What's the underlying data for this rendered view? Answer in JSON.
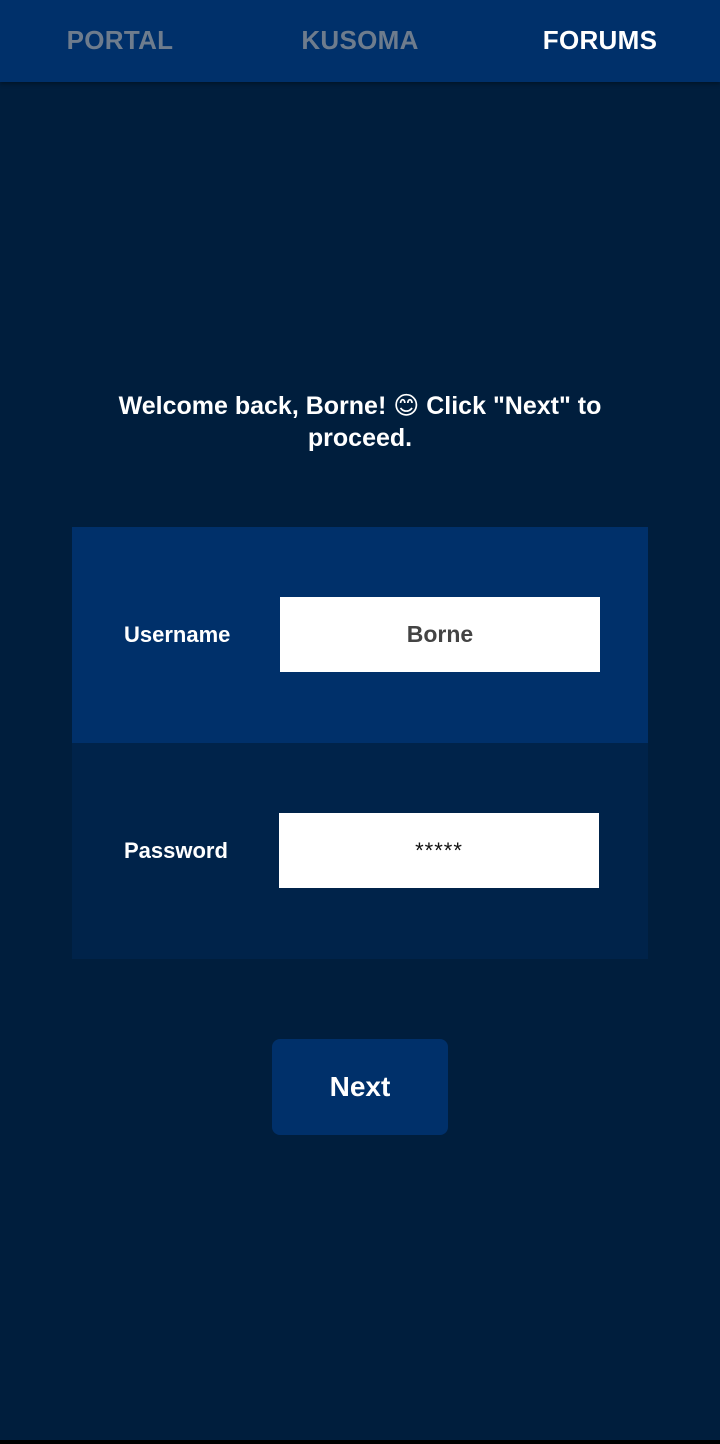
{
  "nav": {
    "tabs": [
      {
        "label": "PORTAL",
        "active": false
      },
      {
        "label": "KUSOMA",
        "active": false
      },
      {
        "label": "FORUMS",
        "active": true
      }
    ]
  },
  "welcome": {
    "message": "Welcome back, Borne! 😊 Click \"Next\" to proceed."
  },
  "form": {
    "username_label": "Username",
    "username_value": "Borne",
    "password_label": "Password",
    "password_value": "*****"
  },
  "actions": {
    "next_label": "Next"
  },
  "colors": {
    "background": "#001e3d",
    "nav_bar": "#00306a",
    "row_username": "#00306a",
    "row_password": "#00234a",
    "button": "#00306a",
    "tab_inactive_text": "#6e7c8d",
    "tab_active_text": "#ffffff"
  }
}
